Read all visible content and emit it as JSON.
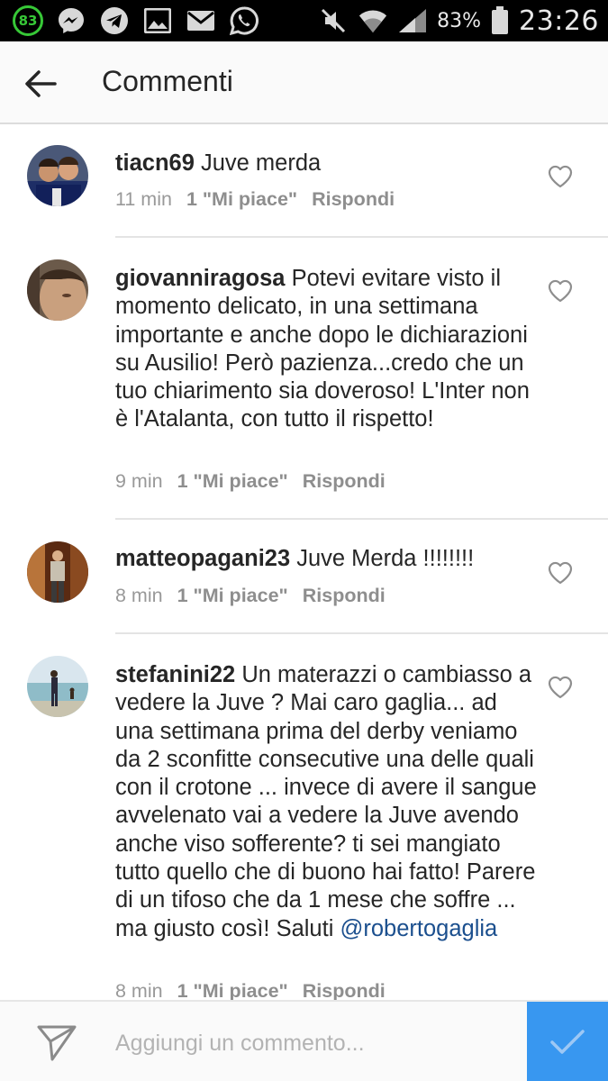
{
  "status_bar": {
    "notification_badge": "83",
    "battery_percent": "83%",
    "time": "23:26"
  },
  "header": {
    "title": "Commenti"
  },
  "comments": [
    {
      "username": "tiacn69",
      "text": "Juve merda",
      "time": "11 min",
      "likes": "1 \"Mi piace\"",
      "reply": "Rispondi"
    },
    {
      "username": "giovanniragosa",
      "text": "Potevi evitare visto il momento delicato, in una settimana importante e anche dopo le dichiarazioni su Ausilio! Però pazienza...credo che un tuo chiarimento sia doveroso! L'Inter non è l'Atalanta, con tutto il rispetto!",
      "time": "9 min",
      "likes": "1 \"Mi piace\"",
      "reply": "Rispondi"
    },
    {
      "username": "matteopagani23",
      "text": "Juve Merda !!!!!!!!",
      "time": "8 min",
      "likes": "1 \"Mi piace\"",
      "reply": "Rispondi"
    },
    {
      "username": "stefanini22",
      "text": "Un materazzi o cambiasso a vedere la Juve ? Mai caro gaglia... ad una settimana prima del derby veniamo da 2 sconfitte consecutive una delle quali con il crotone ... invece di avere il sangue avvelenato vai a vedere la Juve avendo anche viso sofferente? ti sei mangiato tutto quello che di buono hai fatto! Parere di un tifoso che da 1 mese che soffre ... ma giusto così! Saluti",
      "mention": "@robertogaglia",
      "time": "8 min",
      "likes": "1 \"Mi piace\"",
      "reply": "Rispondi"
    }
  ],
  "composer": {
    "placeholder": "Aggiungi un commento..."
  },
  "colors": {
    "accent": "#3897f0",
    "mention": "#1b4f8e",
    "meta_text": "#999999",
    "battery_badge": "#37c837"
  },
  "icons": {
    "back": "arrow-left-icon",
    "like": "heart-outline-icon",
    "send": "paper-plane-icon",
    "post": "checkmark-icon"
  }
}
